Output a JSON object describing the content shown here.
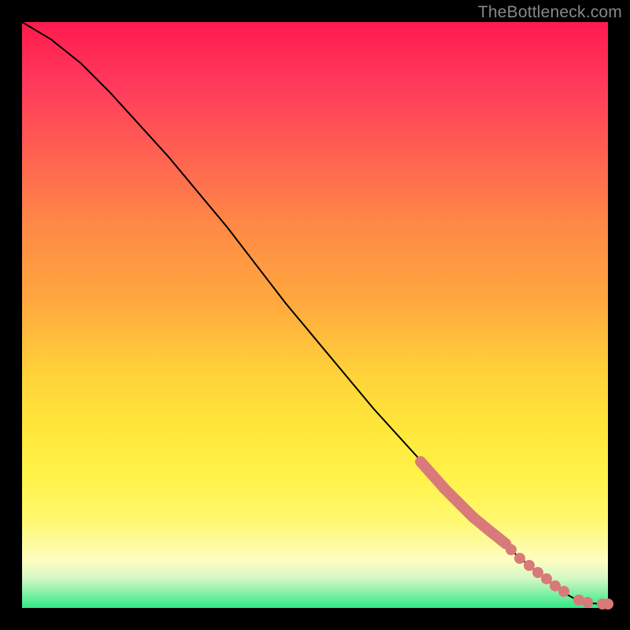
{
  "watermark": "TheBottleneck.com",
  "chart_data": {
    "type": "line",
    "title": "",
    "xlabel": "",
    "ylabel": "",
    "xlim": [
      0,
      100
    ],
    "ylim": [
      0,
      100
    ],
    "curve": [
      {
        "x": 0,
        "y": 100
      },
      {
        "x": 5,
        "y": 97
      },
      {
        "x": 10,
        "y": 93
      },
      {
        "x": 15,
        "y": 88
      },
      {
        "x": 20,
        "y": 82.5
      },
      {
        "x": 25,
        "y": 77
      },
      {
        "x": 30,
        "y": 71
      },
      {
        "x": 35,
        "y": 65
      },
      {
        "x": 40,
        "y": 58.5
      },
      {
        "x": 45,
        "y": 52
      },
      {
        "x": 50,
        "y": 46
      },
      {
        "x": 55,
        "y": 40
      },
      {
        "x": 60,
        "y": 34
      },
      {
        "x": 65,
        "y": 28.5
      },
      {
        "x": 70,
        "y": 23
      },
      {
        "x": 75,
        "y": 18
      },
      {
        "x": 80,
        "y": 13
      },
      {
        "x": 85,
        "y": 8.5
      },
      {
        "x": 90,
        "y": 4.5
      },
      {
        "x": 93,
        "y": 2.3
      },
      {
        "x": 95,
        "y": 1.2
      },
      {
        "x": 97,
        "y": 0.8
      },
      {
        "x": 99,
        "y": 0.7
      },
      {
        "x": 100,
        "y": 0.7
      }
    ],
    "highlight_clusters": [
      {
        "x_start": 68,
        "x_end": 72,
        "y_start": 25,
        "y_end": 20.5
      },
      {
        "x_start": 72,
        "x_end": 77,
        "y_start": 20.5,
        "y_end": 15.5
      },
      {
        "x_start": 77,
        "x_end": 80,
        "y_start": 15.5,
        "y_end": 13
      },
      {
        "x_start": 80,
        "x_end": 82.5,
        "y_start": 13,
        "y_end": 11
      }
    ],
    "highlight_points": [
      {
        "x": 83.5,
        "y": 10
      },
      {
        "x": 85,
        "y": 8.5
      },
      {
        "x": 86.5,
        "y": 7.2
      },
      {
        "x": 88,
        "y": 6
      },
      {
        "x": 89.5,
        "y": 5
      },
      {
        "x": 91,
        "y": 3.8
      },
      {
        "x": 92.5,
        "y": 2.8
      },
      {
        "x": 95,
        "y": 1.3
      },
      {
        "x": 96.5,
        "y": 0.9
      },
      {
        "x": 99,
        "y": 0.7
      },
      {
        "x": 100,
        "y": 0.7
      }
    ]
  }
}
